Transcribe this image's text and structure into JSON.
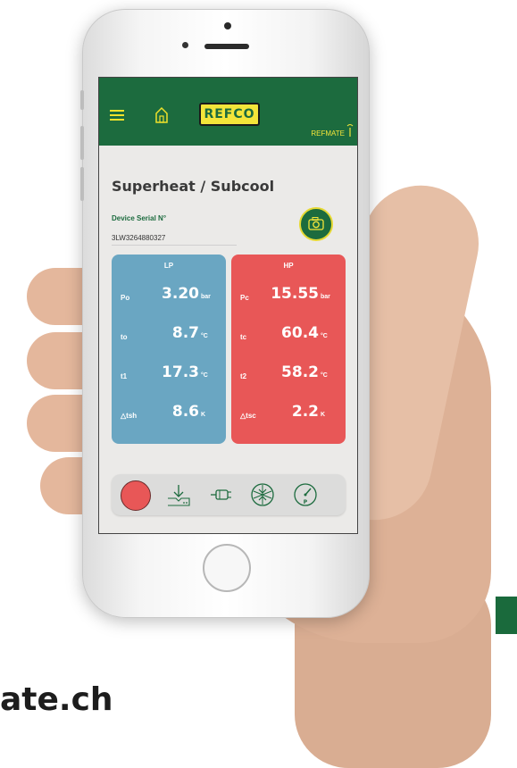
{
  "footer": {
    "website_fragment": "ate.ch"
  },
  "app": {
    "brand": "REFCO",
    "app_name": "REFMATE",
    "page_title": "Superheat / Subcool",
    "device_serial_label": "Device Serial N°",
    "device_serial_value": "3LW3264880327"
  },
  "low_side": {
    "header": "LP",
    "color": "#6aa6c2",
    "rows": [
      {
        "label": "Po",
        "value": "3.20",
        "unit": "bar"
      },
      {
        "label": "to",
        "value": "8.7",
        "unit": "°C"
      },
      {
        "label": "t1",
        "value": "17.3",
        "unit": "°C"
      },
      {
        "label": "△tsh",
        "value": "8.6",
        "unit": "K"
      }
    ]
  },
  "high_side": {
    "header": "HP",
    "color": "#e85757",
    "rows": [
      {
        "label": "Pc",
        "value": "15.55",
        "unit": "bar"
      },
      {
        "label": "tc",
        "value": "60.4",
        "unit": "°C"
      },
      {
        "label": "t2",
        "value": "58.2",
        "unit": "°C"
      },
      {
        "label": "△tsc",
        "value": "2.2",
        "unit": "K"
      }
    ]
  },
  "toolbar": {
    "icons": [
      "record-icon",
      "download-icon",
      "sensor-icon",
      "vacuum-icon",
      "pressure-gauge-icon"
    ]
  },
  "colors": {
    "accent_green": "#1c6b3e",
    "logo_yellow": "#f3e53a"
  }
}
